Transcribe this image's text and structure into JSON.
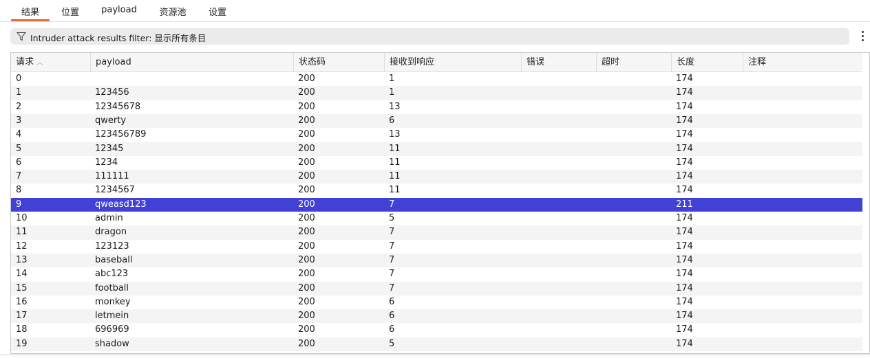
{
  "tabs": [
    {
      "label": "结果",
      "active": true
    },
    {
      "label": "位置",
      "active": false
    },
    {
      "label": "payload",
      "active": false
    },
    {
      "label": "资源池",
      "active": false
    },
    {
      "label": "设置",
      "active": false
    }
  ],
  "filter": {
    "icon": "filter-icon",
    "text": "Intruder attack results filter: 显示所有条目"
  },
  "menu_icon": "kebab-menu-icon",
  "table": {
    "sort_indicator": "︿",
    "columns": [
      "请求",
      "payload",
      "状态码",
      "接收到响应",
      "错误",
      "超时",
      "长度",
      "注释"
    ],
    "selected_row_index": 9,
    "colors": {
      "selected_row": "#4141d6",
      "active_tab_underline": "#e8663c"
    },
    "rows": [
      [
        "0",
        "",
        "200",
        "1",
        "",
        "",
        "174",
        ""
      ],
      [
        "1",
        "123456",
        "200",
        "1",
        "",
        "",
        "174",
        ""
      ],
      [
        "2",
        "12345678",
        "200",
        "13",
        "",
        "",
        "174",
        ""
      ],
      [
        "3",
        "qwerty",
        "200",
        "6",
        "",
        "",
        "174",
        ""
      ],
      [
        "4",
        "123456789",
        "200",
        "13",
        "",
        "",
        "174",
        ""
      ],
      [
        "5",
        "12345",
        "200",
        "11",
        "",
        "",
        "174",
        ""
      ],
      [
        "6",
        "1234",
        "200",
        "11",
        "",
        "",
        "174",
        ""
      ],
      [
        "7",
        "111111",
        "200",
        "11",
        "",
        "",
        "174",
        ""
      ],
      [
        "8",
        "1234567",
        "200",
        "11",
        "",
        "",
        "174",
        ""
      ],
      [
        "9",
        "qweasd123",
        "200",
        "7",
        "",
        "",
        "211",
        ""
      ],
      [
        "10",
        "admin",
        "200",
        "5",
        "",
        "",
        "174",
        ""
      ],
      [
        "11",
        "dragon",
        "200",
        "7",
        "",
        "",
        "174",
        ""
      ],
      [
        "12",
        "123123",
        "200",
        "7",
        "",
        "",
        "174",
        ""
      ],
      [
        "13",
        "baseball",
        "200",
        "7",
        "",
        "",
        "174",
        ""
      ],
      [
        "14",
        "abc123",
        "200",
        "7",
        "",
        "",
        "174",
        ""
      ],
      [
        "15",
        "football",
        "200",
        "7",
        "",
        "",
        "174",
        ""
      ],
      [
        "16",
        "monkey",
        "200",
        "6",
        "",
        "",
        "174",
        ""
      ],
      [
        "17",
        "letmein",
        "200",
        "6",
        "",
        "",
        "174",
        ""
      ],
      [
        "18",
        "696969",
        "200",
        "6",
        "",
        "",
        "174",
        ""
      ],
      [
        "19",
        "shadow",
        "200",
        "5",
        "",
        "",
        "174",
        ""
      ]
    ]
  }
}
